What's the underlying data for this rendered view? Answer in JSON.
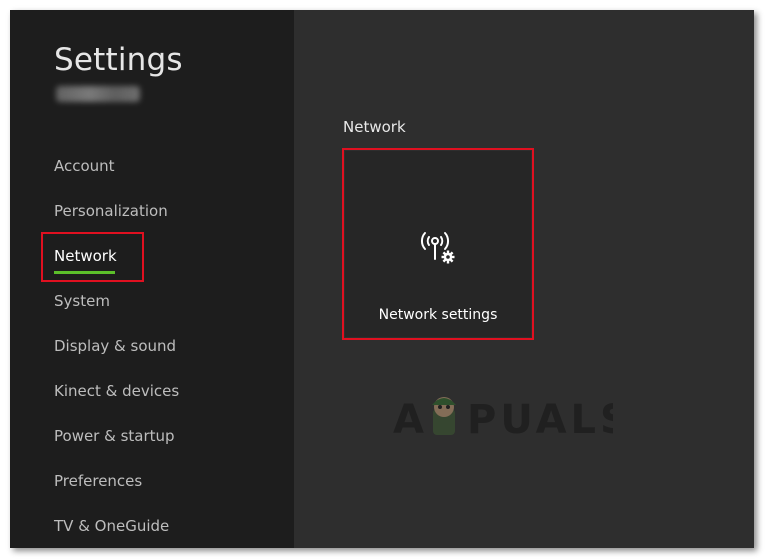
{
  "sidebar": {
    "title": "Settings",
    "gamertag": "jeezipbowl",
    "items": [
      {
        "label": "Account",
        "active": false
      },
      {
        "label": "Personalization",
        "active": false
      },
      {
        "label": "Network",
        "active": true
      },
      {
        "label": "System",
        "active": false
      },
      {
        "label": "Display & sound",
        "active": false
      },
      {
        "label": "Kinect & devices",
        "active": false
      },
      {
        "label": "Power & startup",
        "active": false
      },
      {
        "label": "Preferences",
        "active": false
      },
      {
        "label": "TV & OneGuide",
        "active": false
      }
    ]
  },
  "main": {
    "section_heading": "Network",
    "tiles": [
      {
        "label": "Network settings",
        "icon": "wireless-antenna-gear-icon"
      }
    ]
  },
  "watermark": {
    "text": "A PUALS"
  },
  "colors": {
    "sidebar_bg": "#1d1d1d",
    "main_bg": "#2e2e2e",
    "accent_green": "#5cbf2a",
    "highlight_red": "#e01020"
  }
}
